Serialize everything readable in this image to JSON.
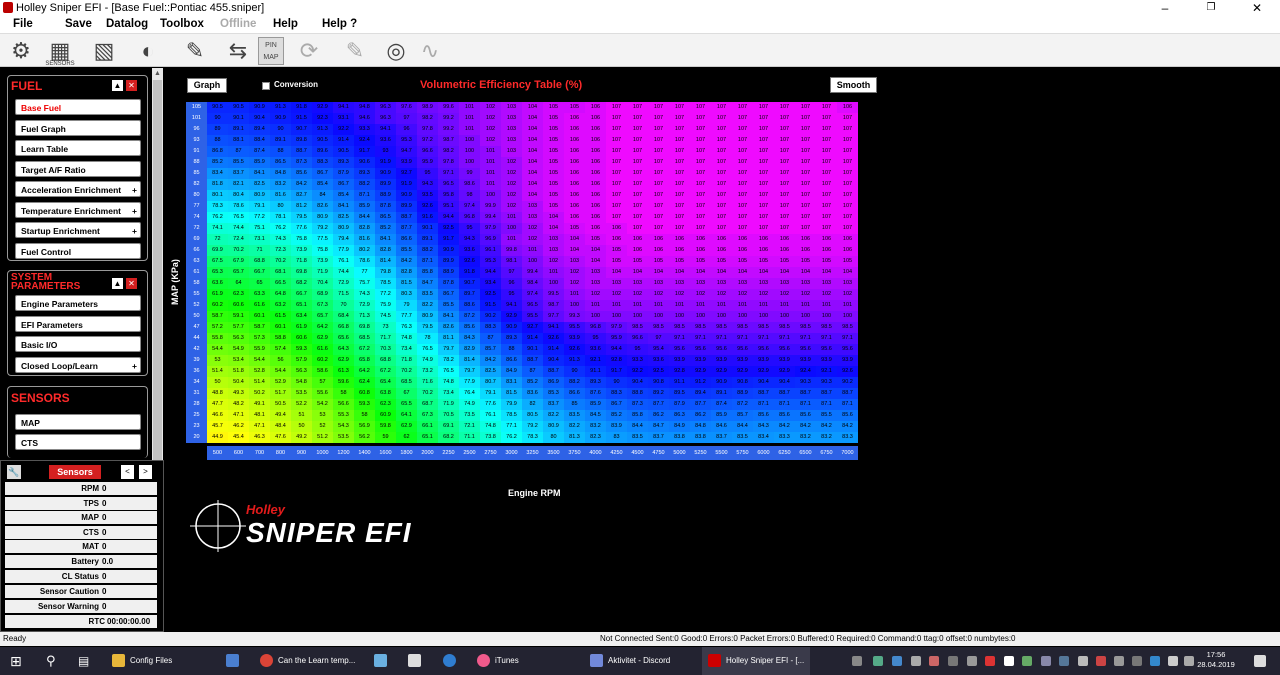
{
  "window": {
    "title": "Holley Sniper EFI - [Base Fuel::Pontiac 455.sniper]"
  },
  "menu": [
    "File",
    "Save",
    "Datalog",
    "Toolbox",
    "Offline",
    "Help",
    "Help ?"
  ],
  "toolbar": {
    "sensors_label": "SENSORS",
    "pin_map_label": "PIN MAP"
  },
  "fuel": {
    "title": "FUEL",
    "items": [
      "Base Fuel",
      "Fuel Graph",
      "Learn Table",
      "Target A/F Ratio",
      "Acceleration Enrichment",
      "Temperature Enrichment",
      "Startup Enrichment",
      "Fuel Control"
    ]
  },
  "system": {
    "title": "SYSTEM PARAMETERS",
    "items": [
      "Engine Parameters",
      "EFI Parameters",
      "Basic I/O",
      "Closed Loop/Learn"
    ]
  },
  "sensors_section": {
    "title": "SENSORS",
    "items": [
      "MAP",
      "CTS"
    ]
  },
  "sensors_panel": {
    "title": "Sensors",
    "rows": [
      {
        "label": "RPM",
        "value": "0"
      },
      {
        "label": "TPS",
        "value": "0"
      },
      {
        "label": "MAP",
        "value": "0"
      },
      {
        "label": "CTS",
        "value": "0"
      },
      {
        "label": "MAT",
        "value": "0"
      },
      {
        "label": "Battery",
        "value": "0.0"
      },
      {
        "label": "CL Status",
        "value": "0"
      },
      {
        "label": "Sensor Caution",
        "value": "0"
      },
      {
        "label": "Sensor Warning",
        "value": "0"
      },
      {
        "label": "RTC",
        "value": "00:00:00.00"
      }
    ]
  },
  "main": {
    "graph_label": "Graph",
    "conversion_label": "Conversion",
    "title": "Volumetric Efficiency Table (%)",
    "smooth_label": "Smooth",
    "y_label": "MAP (KPa)",
    "x_label": "Engine RPM",
    "brand": "Holley",
    "product": "SNIPER EFI"
  },
  "ve_table": {
    "map_kpa": [
      105,
      101,
      96,
      93,
      91,
      88,
      85,
      82,
      80,
      77,
      74,
      72,
      69,
      66,
      63,
      61,
      58,
      55,
      52,
      50,
      47,
      44,
      42,
      39,
      36,
      34,
      31,
      28,
      25,
      23,
      20
    ],
    "rpm": [
      500,
      600,
      700,
      800,
      900,
      1000,
      1200,
      1400,
      1600,
      1800,
      2000,
      2250,
      2500,
      2750,
      3000,
      3250,
      3500,
      3750,
      4000,
      4250,
      4500,
      4750,
      5000,
      5250,
      5500,
      5750,
      6000,
      6250,
      6500,
      6750,
      7000
    ],
    "rows": [
      [
        90.5,
        90.5,
        90.9,
        91.3,
        91.8,
        92.9,
        94.1,
        94.8,
        96.3,
        97.6,
        98.9,
        99.6,
        101,
        102,
        103,
        104,
        105,
        105,
        106,
        107,
        107,
        107,
        107,
        107,
        107,
        107,
        107,
        107,
        107,
        107,
        106
      ],
      [
        90.0,
        90.1,
        90.4,
        90.9,
        91.5,
        92.3,
        93.1,
        94.6,
        96.3,
        97.0,
        98.2,
        99.2,
        101,
        102,
        103,
        104,
        105,
        106,
        106,
        107,
        107,
        107,
        107,
        107,
        107,
        107,
        107,
        107,
        107,
        107,
        107
      ],
      [
        89.0,
        89.1,
        89.4,
        90.0,
        90.7,
        91.3,
        92.2,
        93.3,
        94.1,
        96.0,
        97.8,
        99.2,
        101,
        102,
        103,
        104,
        105,
        106,
        106,
        107,
        107,
        107,
        107,
        107,
        107,
        107,
        107,
        107,
        107,
        107,
        107
      ],
      [
        88.0,
        88.1,
        88.4,
        89.1,
        89.8,
        90.5,
        91.4,
        92.4,
        93.6,
        95.3,
        97.2,
        98.7,
        100,
        102,
        103,
        104,
        105,
        106,
        106,
        107,
        107,
        107,
        107,
        107,
        107,
        107,
        107,
        107,
        107,
        107,
        107
      ],
      [
        86.8,
        87.0,
        87.4,
        88.0,
        88.7,
        89.6,
        90.5,
        91.7,
        93.0,
        94.7,
        96.6,
        98.2,
        100,
        101,
        103,
        104,
        105,
        106,
        106,
        107,
        107,
        107,
        107,
        107,
        107,
        107,
        107,
        107,
        107,
        107,
        107
      ],
      [
        85.2,
        85.5,
        85.9,
        86.5,
        87.3,
        88.3,
        89.3,
        90.6,
        91.9,
        93.9,
        95.9,
        97.8,
        100,
        101,
        102,
        104,
        105,
        106,
        106,
        107,
        107,
        107,
        107,
        107,
        107,
        107,
        107,
        107,
        107,
        107,
        107
      ],
      [
        83.4,
        83.7,
        84.1,
        84.8,
        85.6,
        86.7,
        87.9,
        89.3,
        90.9,
        92.7,
        95.0,
        97.1,
        99.0,
        101,
        102,
        104,
        105,
        106,
        106,
        107,
        107,
        107,
        107,
        107,
        107,
        107,
        107,
        107,
        107,
        107,
        107
      ],
      [
        81.8,
        82.1,
        82.5,
        83.2,
        84.2,
        85.4,
        86.7,
        88.2,
        89.9,
        91.9,
        94.3,
        96.5,
        98.6,
        101,
        102,
        104,
        105,
        106,
        106,
        107,
        107,
        107,
        107,
        107,
        107,
        107,
        107,
        107,
        107,
        107,
        107
      ],
      [
        80.1,
        80.4,
        80.9,
        81.6,
        82.7,
        84.0,
        85.4,
        87.1,
        88.9,
        90.9,
        93.5,
        95.8,
        98.0,
        100,
        102,
        104,
        105,
        106,
        106,
        107,
        107,
        107,
        107,
        107,
        107,
        107,
        107,
        107,
        107,
        107,
        107
      ],
      [
        78.3,
        78.6,
        79.1,
        80.0,
        81.2,
        82.6,
        84.1,
        85.9,
        87.8,
        89.9,
        92.6,
        95.1,
        97.4,
        99.9,
        102,
        103,
        105,
        106,
        106,
        107,
        107,
        107,
        107,
        107,
        107,
        107,
        107,
        107,
        107,
        107,
        107
      ],
      [
        76.2,
        76.5,
        77.2,
        78.1,
        79.5,
        80.9,
        82.5,
        84.4,
        86.5,
        88.7,
        91.6,
        94.4,
        96.8,
        99.4,
        101,
        103,
        104,
        106,
        106,
        107,
        107,
        107,
        107,
        107,
        107,
        107,
        107,
        107,
        107,
        107,
        107
      ],
      [
        74.1,
        74.4,
        75.1,
        76.2,
        77.6,
        79.2,
        80.9,
        82.8,
        85.2,
        87.7,
        90.1,
        92.5,
        95.0,
        97.9,
        100,
        102,
        104,
        105,
        106,
        106,
        107,
        107,
        107,
        107,
        107,
        107,
        107,
        107,
        107,
        107,
        107
      ],
      [
        72.0,
        72.4,
        73.1,
        74.3,
        75.8,
        77.5,
        79.4,
        81.6,
        84.1,
        86.6,
        89.1,
        91.7,
        94.3,
        96.9,
        101,
        102,
        103,
        104,
        105,
        106,
        106,
        106,
        106,
        106,
        106,
        106,
        106,
        106,
        106,
        106,
        106
      ],
      [
        69.9,
        70.2,
        71.0,
        72.3,
        73.9,
        75.8,
        77.9,
        80.2,
        82.8,
        85.5,
        88.2,
        90.9,
        93.6,
        96.1,
        99.8,
        101,
        103,
        104,
        104,
        105,
        106,
        106,
        106,
        106,
        106,
        106,
        106,
        106,
        106,
        106,
        106
      ],
      [
        67.5,
        67.9,
        68.8,
        70.2,
        71.8,
        73.9,
        76.1,
        78.6,
        81.4,
        84.2,
        87.1,
        89.9,
        92.6,
        95.3,
        98.1,
        100,
        102,
        103,
        104,
        105,
        105,
        105,
        105,
        105,
        105,
        105,
        105,
        105,
        105,
        105,
        105
      ],
      [
        65.3,
        65.7,
        66.7,
        68.1,
        69.8,
        71.9,
        74.4,
        77.0,
        79.8,
        82.8,
        85.8,
        88.9,
        91.8,
        94.4,
        97.0,
        99.4,
        101,
        102,
        103,
        104,
        104,
        104,
        104,
        104,
        104,
        104,
        104,
        104,
        104,
        104,
        104
      ],
      [
        63.6,
        64.0,
        65.0,
        66.5,
        68.2,
        70.4,
        72.9,
        75.7,
        78.5,
        81.5,
        84.7,
        87.8,
        90.7,
        93.4,
        96.0,
        98.4,
        100,
        102,
        103,
        103,
        103,
        103,
        103,
        103,
        103,
        103,
        103,
        103,
        103,
        103,
        103
      ],
      [
        61.9,
        62.3,
        63.3,
        64.8,
        66.7,
        68.9,
        71.5,
        74.3,
        77.2,
        80.3,
        83.5,
        86.7,
        89.7,
        92.5,
        95.0,
        97.4,
        99.5,
        101,
        102,
        102,
        102,
        102,
        102,
        102,
        102,
        102,
        102,
        102,
        102,
        102,
        102
      ],
      [
        60.2,
        60.6,
        61.6,
        63.2,
        65.1,
        67.3,
        70.0,
        72.9,
        75.9,
        79.0,
        82.2,
        85.5,
        88.6,
        91.5,
        94.1,
        96.5,
        98.7,
        100,
        101,
        101,
        101,
        101,
        101,
        101,
        101,
        101,
        101,
        101,
        101,
        101,
        101
      ],
      [
        58.7,
        59.1,
        60.1,
        61.5,
        63.4,
        65.7,
        68.4,
        71.3,
        74.5,
        77.7,
        80.9,
        84.1,
        87.2,
        90.2,
        92.9,
        95.5,
        97.7,
        99.3,
        100,
        100,
        100,
        100,
        100,
        100,
        100,
        100,
        100,
        100,
        100,
        100,
        100
      ],
      [
        57.2,
        57.7,
        58.7,
        60.1,
        61.9,
        64.2,
        66.8,
        69.8,
        73.0,
        76.3,
        79.5,
        82.6,
        85.6,
        88.3,
        90.9,
        92.7,
        94.1,
        95.5,
        96.8,
        97.9,
        98.5,
        98.5,
        98.5,
        98.5,
        98.5,
        98.5,
        98.5,
        98.5,
        98.5,
        98.5,
        98.5
      ],
      [
        55.8,
        56.3,
        57.3,
        58.8,
        60.6,
        62.9,
        65.6,
        68.5,
        71.7,
        74.8,
        78.0,
        81.1,
        84.3,
        87.0,
        89.3,
        91.4,
        92.6,
        93.9,
        95.0,
        95.9,
        96.6,
        97.0,
        97.1,
        97.1,
        97.1,
        97.1,
        97.1,
        97.1,
        97.1,
        97.1,
        97.1
      ],
      [
        54.4,
        54.9,
        55.9,
        57.4,
        59.3,
        61.6,
        64.3,
        67.2,
        70.3,
        73.4,
        76.5,
        79.7,
        82.9,
        85.7,
        88.0,
        90.1,
        91.4,
        92.6,
        93.6,
        94.4,
        95.0,
        95.4,
        95.6,
        95.6,
        95.6,
        95.6,
        95.6,
        95.6,
        95.6,
        95.6,
        95.6
      ],
      [
        53.0,
        53.4,
        54.4,
        56.0,
        57.9,
        60.2,
        62.9,
        65.8,
        68.8,
        71.8,
        74.9,
        78.2,
        81.4,
        84.2,
        86.6,
        88.7,
        90.4,
        91.3,
        92.1,
        92.8,
        93.3,
        93.6,
        93.9,
        93.9,
        93.9,
        93.9,
        93.9,
        93.9,
        93.9,
        93.9,
        93.9
      ],
      [
        51.4,
        51.8,
        52.8,
        54.4,
        56.3,
        58.6,
        61.3,
        64.2,
        67.2,
        70.2,
        73.2,
        76.5,
        79.7,
        82.5,
        84.9,
        87.0,
        88.7,
        90.0,
        91.1,
        91.7,
        92.2,
        92.5,
        92.8,
        92.9,
        92.9,
        92.9,
        92.9,
        92.9,
        92.4,
        92.1,
        92.6
      ],
      [
        50.0,
        50.4,
        51.4,
        52.9,
        54.8,
        57.0,
        59.6,
        62.4,
        65.4,
        68.5,
        71.6,
        74.8,
        77.9,
        80.7,
        83.1,
        85.2,
        86.9,
        88.2,
        89.3,
        90.0,
        90.4,
        90.8,
        91.1,
        91.2,
        90.9,
        90.8,
        90.4,
        90.4,
        90.3,
        90.3,
        90.2
      ],
      [
        48.8,
        49.3,
        50.2,
        51.7,
        53.5,
        55.6,
        58.0,
        60.8,
        63.8,
        67.0,
        70.2,
        73.4,
        76.4,
        79.1,
        81.5,
        83.6,
        85.3,
        86.6,
        87.6,
        88.3,
        88.8,
        89.2,
        89.5,
        89.4,
        89.1,
        88.9,
        88.7,
        88.7,
        88.7,
        88.7,
        88.7
      ],
      [
        47.7,
        48.2,
        49.1,
        50.5,
        52.2,
        54.2,
        56.6,
        59.3,
        62.3,
        65.5,
        68.7,
        71.9,
        74.9,
        77.6,
        79.9,
        82.0,
        83.7,
        85.0,
        85.9,
        86.7,
        87.3,
        87.7,
        87.9,
        87.7,
        87.4,
        87.2,
        87.1,
        87.1,
        87.1,
        87.1,
        87.1
      ],
      [
        46.6,
        47.1,
        48.1,
        49.4,
        51.0,
        53.0,
        55.3,
        58.0,
        60.9,
        64.1,
        67.3,
        70.5,
        73.5,
        76.1,
        78.5,
        80.5,
        82.2,
        83.5,
        84.5,
        85.2,
        85.8,
        86.2,
        86.3,
        86.2,
        85.9,
        85.7,
        85.6,
        85.6,
        85.6,
        85.5,
        85.6
      ],
      [
        45.7,
        46.2,
        47.1,
        48.4,
        50.0,
        52.0,
        54.3,
        56.9,
        59.8,
        62.9,
        66.1,
        69.1,
        72.1,
        74.8,
        77.1,
        79.2,
        80.9,
        82.2,
        83.2,
        83.9,
        84.4,
        84.7,
        84.9,
        84.8,
        84.6,
        84.4,
        84.3,
        84.2,
        84.2,
        84.2,
        84.2
      ],
      [
        44.9,
        45.4,
        46.3,
        47.6,
        49.2,
        51.2,
        53.5,
        56.2,
        59.0,
        62.0,
        65.1,
        68.2,
        71.1,
        73.8,
        76.2,
        78.3,
        80.0,
        81.3,
        82.3,
        83.0,
        83.5,
        83.7,
        83.8,
        83.8,
        83.7,
        83.5,
        83.4,
        83.3,
        83.2,
        83.2,
        83.3
      ]
    ]
  },
  "status": {
    "ready": "Ready",
    "connection": "Not Connected  Sent:0 Good:0 Errors:0 Packet Errors:0 Buffered:0 Required:0    Command:0 ttag:0 offset:0 numbytes:0"
  },
  "taskbar": {
    "items": [
      "Config Files",
      "Can the Learn temp...",
      "iTunes",
      "Aktivitet - Discord",
      "Holley Sniper EFI - [..."
    ],
    "time": "17:56",
    "date": "28.04.2019"
  }
}
